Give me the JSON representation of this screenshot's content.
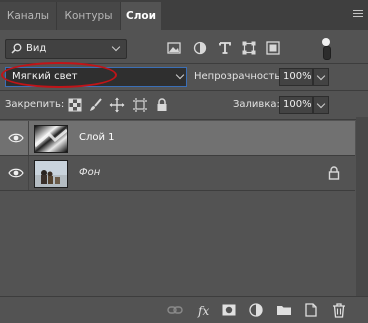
{
  "tabs": [
    {
      "label": "Каналы",
      "active": false
    },
    {
      "label": "Контуры",
      "active": false
    },
    {
      "label": "Слои",
      "active": true
    }
  ],
  "filter": {
    "search_icon": "search-icon",
    "label": "Вид"
  },
  "blend": {
    "mode": "Мягкий свет"
  },
  "opacity": {
    "label": "Непрозрачность:",
    "value": "100%"
  },
  "lock": {
    "label": "Закрепить:"
  },
  "fill": {
    "label": "Заливка:",
    "value": "100%"
  },
  "layers": [
    {
      "name": "Слой 1",
      "selected": true,
      "visible": true
    },
    {
      "name": "Фон",
      "selected": false,
      "visible": true,
      "locked": true
    }
  ],
  "colors": {
    "accent": "#3b6fb6",
    "annotation": "#c01418",
    "panel": "#535353"
  }
}
